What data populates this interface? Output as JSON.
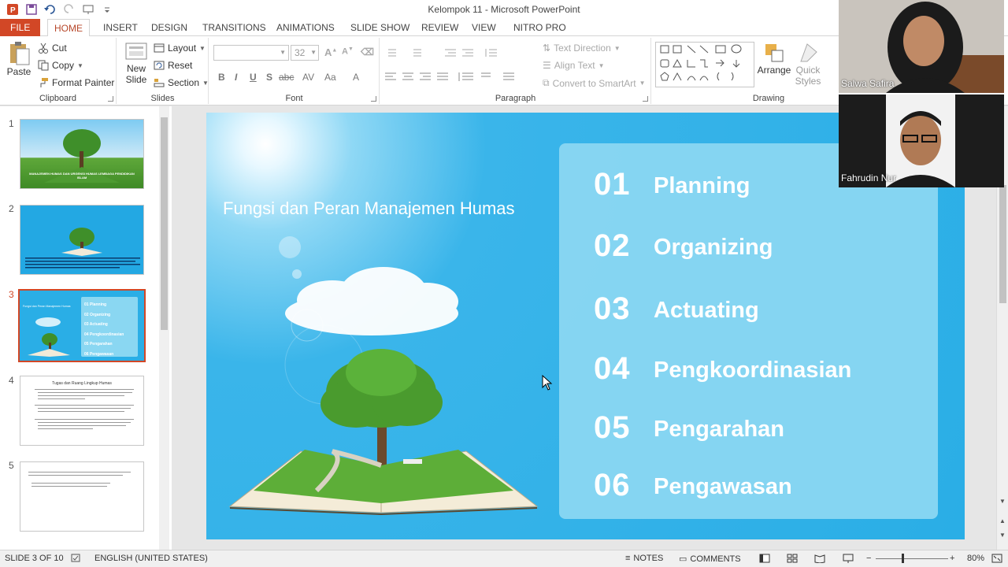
{
  "window": {
    "title": "Kelompok 11 - Microsoft PowerPoint"
  },
  "ribbon_tabs": [
    "FILE",
    "HOME",
    "INSERT",
    "DESIGN",
    "TRANSITIONS",
    "ANIMATIONS",
    "SLIDE SHOW",
    "REVIEW",
    "VIEW",
    "NITRO PRO"
  ],
  "active_tab": "HOME",
  "clipboard": {
    "paste": "Paste",
    "cut": "Cut",
    "copy": "Copy",
    "format_painter": "Format Painter",
    "label": "Clipboard"
  },
  "slides_group": {
    "new_slide": "New Slide",
    "layout": "Layout",
    "reset": "Reset",
    "section": "Section",
    "label": "Slides"
  },
  "font_group": {
    "font_name": "",
    "font_size": "32",
    "label": "Font",
    "bold": "B",
    "italic": "I",
    "underline": "U",
    "shadow": "S",
    "strike": "abc",
    "spacing": "AV",
    "case": "Aa",
    "color": "A"
  },
  "paragraph_group": {
    "text_direction": "Text Direction",
    "align_text": "Align Text",
    "convert_smartart": "Convert to SmartArt",
    "label": "Paragraph"
  },
  "drawing_group": {
    "arrange": "Arrange",
    "quick_styles": "Quick Styles",
    "label": "Drawing"
  },
  "thumbnails": [
    {
      "num": "1",
      "title": "MANAJEMEN HUMAS DAN URGENSI HUMAS LEMBAGA PENDIDIKAN ISLAM"
    },
    {
      "num": "2",
      "title": ""
    },
    {
      "num": "3",
      "title": "Fungsi dan Peran Manajemen Humas",
      "items": [
        "01 Planning",
        "02 Organizing",
        "03 Actuating",
        "04 Pengkoordinasian",
        "05 Pengarahan",
        "06 Pengawasan"
      ]
    },
    {
      "num": "4",
      "title": "Tugas dan Ruang Lingkup Humas"
    },
    {
      "num": "5",
      "title": ""
    }
  ],
  "slide": {
    "title": "Fungsi dan Peran Manajemen Humas",
    "items": [
      {
        "num": "01",
        "label": "Planning"
      },
      {
        "num": "02",
        "label": "Organizing"
      },
      {
        "num": "03",
        "label": "Actuating"
      },
      {
        "num": "04",
        "label": "Pengkoordinasian"
      },
      {
        "num": "05",
        "label": "Pengarahan"
      },
      {
        "num": "06",
        "label": "Pengawasan"
      }
    ]
  },
  "participants": [
    {
      "name": "Salwa Safira"
    },
    {
      "name": "Fahrudin Nur"
    }
  ],
  "status": {
    "slide_info": "SLIDE 3 OF 10",
    "language": "ENGLISH (UNITED STATES)",
    "notes": "NOTES",
    "comments": "COMMENTS",
    "zoom": "80%"
  },
  "colors": {
    "accent": "#d24726",
    "slide_bg": "#2aaee6",
    "panel": "#8ad7f2"
  }
}
